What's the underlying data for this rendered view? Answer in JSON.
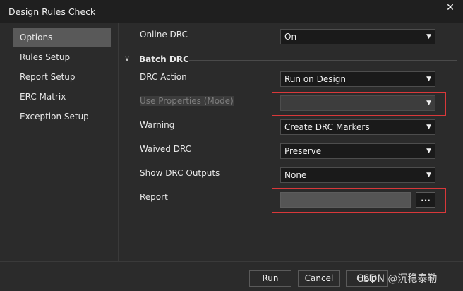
{
  "window": {
    "title": "Design Rules Check"
  },
  "sidebar": {
    "items": [
      {
        "label": "Options"
      },
      {
        "label": "Rules Setup"
      },
      {
        "label": "Report Setup"
      },
      {
        "label": "ERC Matrix"
      },
      {
        "label": "Exception Setup"
      }
    ]
  },
  "options": {
    "online_drc": {
      "label": "Online DRC",
      "value": "On"
    },
    "batch_section": "Batch DRC",
    "drc_action": {
      "label": "DRC Action",
      "value": "Run on Design"
    },
    "use_properties": {
      "label": "Use Properties (Mode)",
      "value": ""
    },
    "warning": {
      "label": "Warning",
      "value": "Create DRC Markers"
    },
    "waived_drc": {
      "label": "Waived DRC",
      "value": "Preserve"
    },
    "show_outputs": {
      "label": "Show DRC Outputs",
      "value": "None"
    },
    "report": {
      "label": "Report",
      "value": "",
      "browse_label": "..."
    }
  },
  "footer": {
    "run_label": "Run",
    "cancel_label": "Cancel",
    "help_label": "Help"
  },
  "watermark": "CSDN @沉稳泰勒",
  "colors": {
    "highlight": "#d9383a",
    "active_item": "#595959"
  }
}
